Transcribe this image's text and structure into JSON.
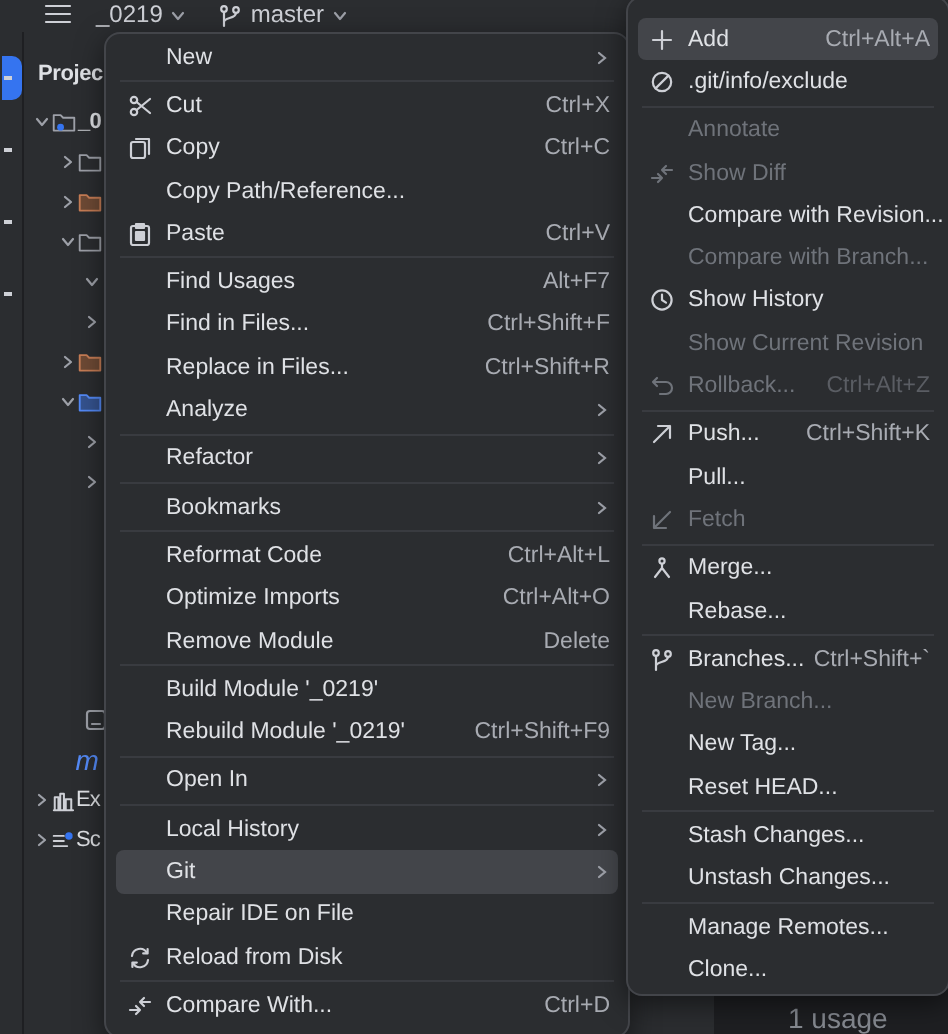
{
  "toolbar": {
    "project": "_0219",
    "branch": "master"
  },
  "project_panel": {
    "title": "Projec",
    "tree": [
      {
        "label": "_0",
        "kind": "module",
        "expanded": true,
        "children": [
          {
            "kind": "folder",
            "expanded": false
          },
          {
            "kind": "excluded-folder",
            "expanded": false
          },
          {
            "kind": "folder",
            "expanded": true,
            "children": [
              {
                "expanded": true
              },
              {
                "expanded": false
              }
            ]
          },
          {
            "kind": "excluded-folder",
            "expanded": false
          },
          {
            "kind": "source-folder",
            "expanded": true,
            "children": [
              {
                "expanded": false
              },
              {
                "expanded": false
              }
            ]
          }
        ]
      }
    ],
    "bottom_items": [
      {
        "kind": "file"
      },
      {
        "kind": "module-file",
        "label": "m"
      },
      {
        "kind": "libraries",
        "label": "Ex",
        "expanded": false
      },
      {
        "kind": "scratches",
        "label": "Sc",
        "expanded": false
      }
    ]
  },
  "context_menu": {
    "groups": [
      [
        {
          "label": "New",
          "submenu": true,
          "selected": false
        }
      ],
      [
        {
          "label": "Cut",
          "shortcut": "Ctrl+X",
          "kind": "cut",
          "selected": false
        },
        {
          "label": "Copy",
          "shortcut": "Ctrl+C",
          "kind": "copy",
          "selected": false
        },
        {
          "label": "Copy Path/Reference...",
          "selected": false
        },
        {
          "label": "Paste",
          "shortcut": "Ctrl+V",
          "kind": "paste",
          "selected": false
        }
      ],
      [
        {
          "label": "Find Usages",
          "shortcut": "Alt+F7",
          "selected": false
        },
        {
          "label": "Find in Files...",
          "shortcut": "Ctrl+Shift+F",
          "selected": false
        },
        {
          "label": "Replace in Files...",
          "shortcut": "Ctrl+Shift+R",
          "selected": false
        },
        {
          "label": "Analyze",
          "submenu": true,
          "selected": false
        }
      ],
      [
        {
          "label": "Refactor",
          "submenu": true,
          "selected": false
        }
      ],
      [
        {
          "label": "Bookmarks",
          "submenu": true,
          "selected": false
        }
      ],
      [
        {
          "label": "Reformat Code",
          "shortcut": "Ctrl+Alt+L",
          "selected": false
        },
        {
          "label": "Optimize Imports",
          "shortcut": "Ctrl+Alt+O",
          "selected": false
        },
        {
          "label": "Remove Module",
          "shortcut": "Delete",
          "selected": false
        }
      ],
      [
        {
          "label": "Build Module '_0219'",
          "selected": false
        },
        {
          "label": "Rebuild Module '_0219'",
          "shortcut": "Ctrl+Shift+F9",
          "selected": false
        }
      ],
      [
        {
          "label": "Open In",
          "submenu": true,
          "selected": false
        }
      ],
      [
        {
          "label": "Local History",
          "submenu": true,
          "selected": false
        },
        {
          "label": "Git",
          "submenu": true,
          "selected": true
        },
        {
          "label": "Repair IDE on File",
          "selected": false
        },
        {
          "label": "Reload from Disk",
          "kind": "reload",
          "selected": false
        }
      ],
      [
        {
          "label": "Compare With...",
          "shortcut": "Ctrl+D",
          "kind": "compare",
          "selected": false
        }
      ]
    ]
  },
  "git_submenu": {
    "groups": [
      [
        {
          "label": "Add",
          "shortcut": "Ctrl+Alt+A",
          "kind": "add",
          "disabled": false,
          "selected": true
        },
        {
          "label": ".git/info/exclude",
          "kind": "ignore",
          "disabled": false,
          "selected": false
        }
      ],
      [
        {
          "label": "Annotate",
          "disabled": true,
          "selected": false
        },
        {
          "label": "Show Diff",
          "kind": "diff",
          "disabled": true,
          "selected": false
        },
        {
          "label": "Compare with Revision...",
          "disabled": false,
          "selected": false
        },
        {
          "label": "Compare with Branch...",
          "disabled": true,
          "selected": false
        },
        {
          "label": "Show History",
          "kind": "history",
          "disabled": false,
          "selected": false
        },
        {
          "label": "Show Current Revision",
          "disabled": true,
          "selected": false
        },
        {
          "label": "Rollback...",
          "shortcut": "Ctrl+Alt+Z",
          "kind": "rollback",
          "disabled": true,
          "selected": false
        }
      ],
      [
        {
          "label": "Push...",
          "shortcut": "Ctrl+Shift+K",
          "kind": "push",
          "disabled": false,
          "selected": false
        },
        {
          "label": "Pull...",
          "disabled": false,
          "selected": false
        },
        {
          "label": "Fetch",
          "kind": "fetch",
          "disabled": true,
          "selected": false
        }
      ],
      [
        {
          "label": "Merge...",
          "kind": "merge",
          "disabled": false,
          "selected": false
        },
        {
          "label": "Rebase...",
          "disabled": false,
          "selected": false
        }
      ],
      [
        {
          "label": "Branches...",
          "shortcut": "Ctrl+Shift+`",
          "kind": "branches",
          "disabled": false,
          "selected": false
        },
        {
          "label": "New Branch...",
          "disabled": true,
          "selected": false
        },
        {
          "label": "New Tag...",
          "disabled": false,
          "selected": false
        },
        {
          "label": "Reset HEAD...",
          "disabled": false,
          "selected": false
        }
      ],
      [
        {
          "label": "Stash Changes...",
          "disabled": false,
          "selected": false
        },
        {
          "label": "Unstash Changes...",
          "disabled": false,
          "selected": false
        }
      ],
      [
        {
          "label": "Manage Remotes...",
          "disabled": false,
          "selected": false
        },
        {
          "label": "Clone...",
          "disabled": false,
          "selected": false
        }
      ]
    ]
  },
  "editor": {
    "usage_hint": "1 usage"
  }
}
